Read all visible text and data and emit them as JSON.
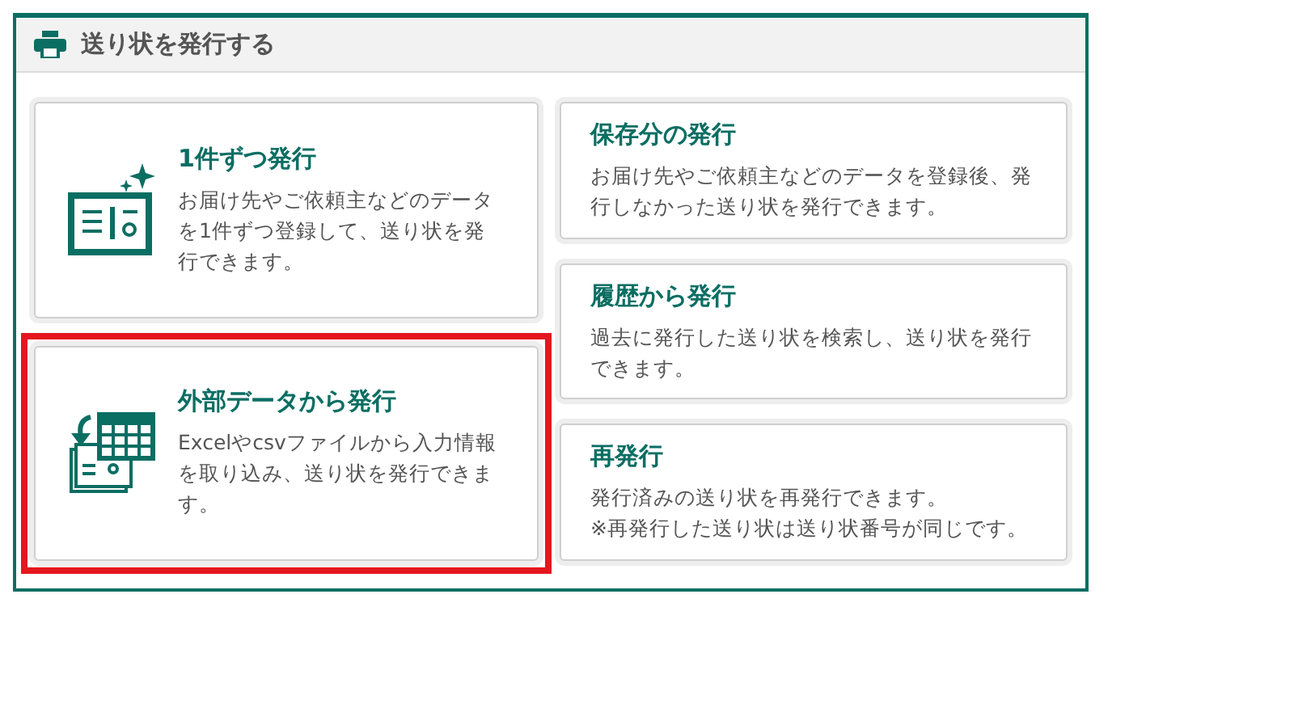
{
  "panel": {
    "title": "送り状を発行する"
  },
  "left_cards": [
    {
      "kind": "single",
      "title": "1件ずつ発行",
      "description": "お届け先やご依頼主などのデータを1件ずつ登録して、送り状を発行できます。",
      "highlighted": false
    },
    {
      "kind": "import",
      "title": "外部データから発行",
      "description": "Excelやcsvファイルから入力情報を取り込み、送り状を発行できます。",
      "highlighted": true
    }
  ],
  "right_cards": [
    {
      "title": "保存分の発行",
      "description": "お届け先やご依頼主などのデータを登録後、発行しなかった送り状を発行できます。",
      "highlighted": false
    },
    {
      "title": "履歴から発行",
      "description": "過去に発行した送り状を検索し、送り状を発行できます。",
      "highlighted": false
    },
    {
      "title": "再発行",
      "description": "発行済みの送り状を再発行できます。\n※再発行した送り状は送り状番号が同じです。",
      "highlighted": false
    }
  ]
}
